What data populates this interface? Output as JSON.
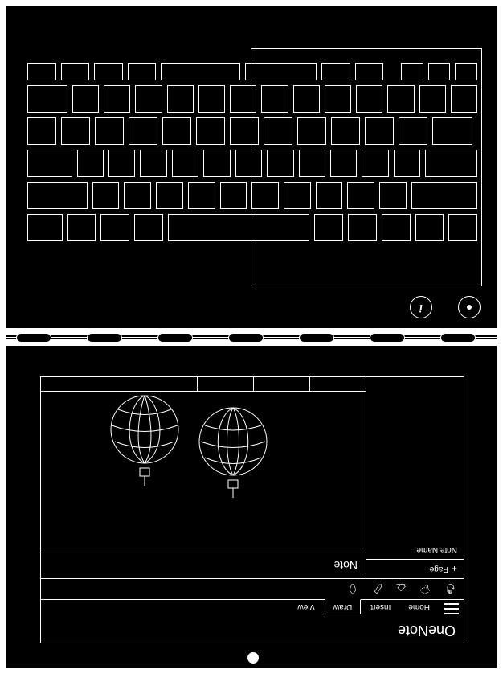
{
  "colors": {
    "bg": "#000000",
    "stroke": "#ffffff"
  },
  "top_panel": {
    "buttons": {
      "info_label": "i"
    }
  },
  "app": {
    "title": "OneNote",
    "tabs": [
      {
        "label": "Home"
      },
      {
        "label": "Insert"
      },
      {
        "label": "Draw",
        "active": true
      },
      {
        "label": "View"
      }
    ],
    "ribbon_tools": [
      {
        "name": "hand-tool-icon"
      },
      {
        "name": "lasso-icon"
      },
      {
        "name": "eraser-icon"
      },
      {
        "name": "pen-icon"
      },
      {
        "name": "marker-icon"
      }
    ],
    "page_list": {
      "add_label": "Page",
      "items": [
        {
          "label": "Note Name"
        }
      ]
    },
    "note": {
      "title": "Note"
    }
  }
}
